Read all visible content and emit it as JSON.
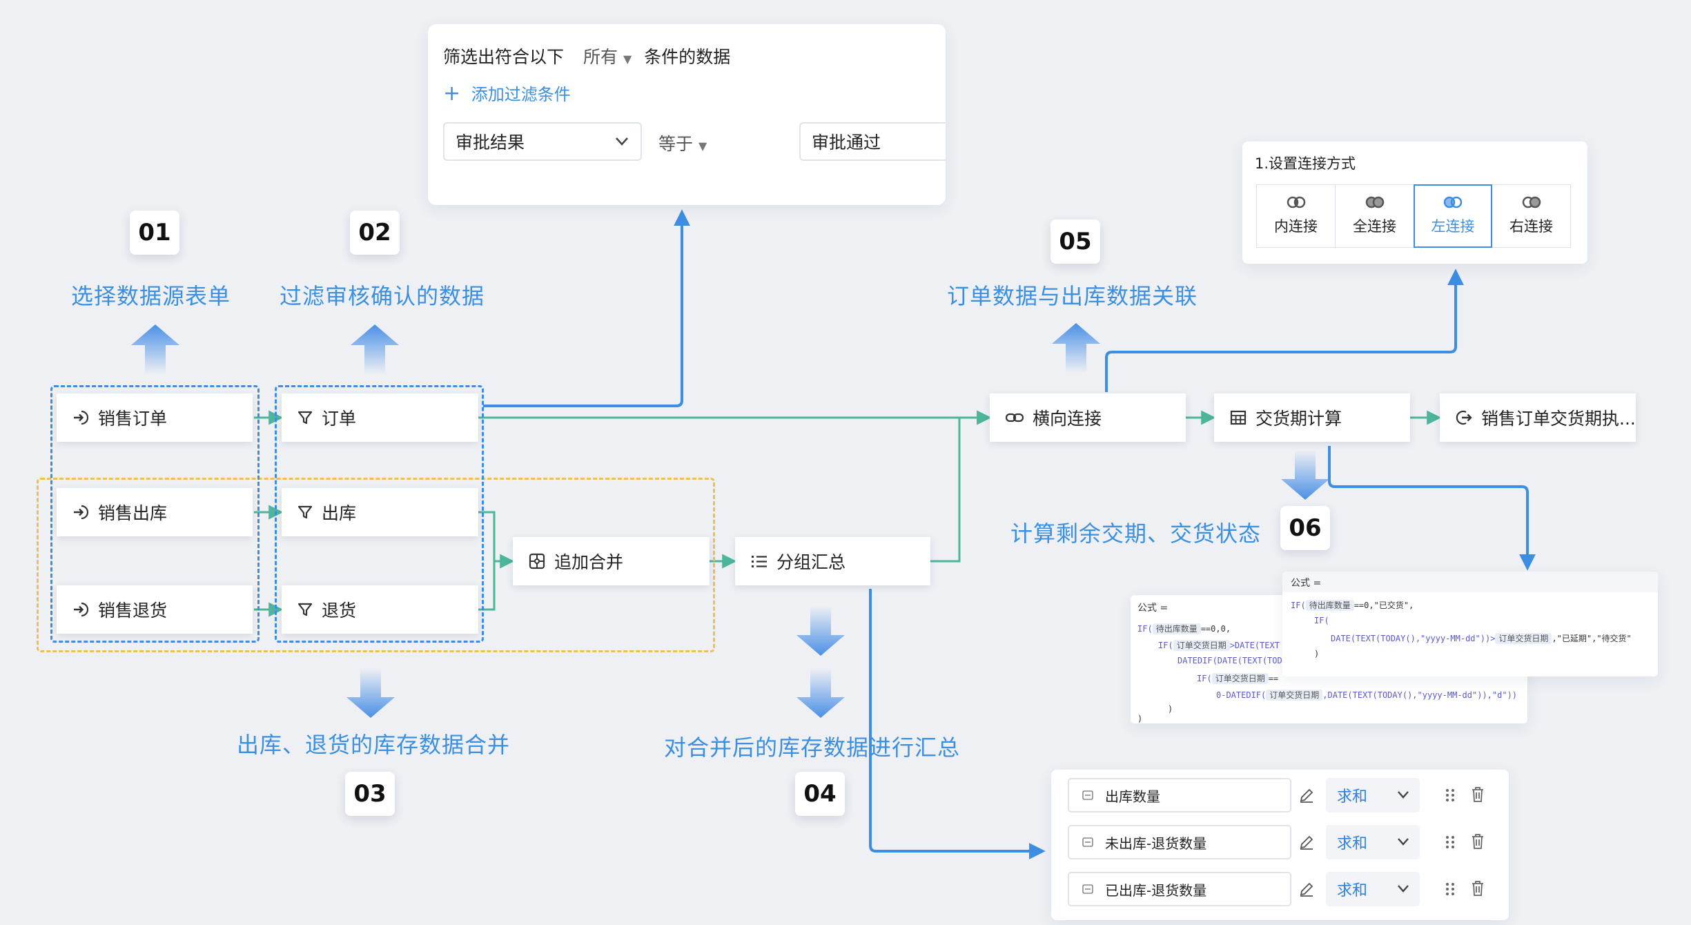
{
  "filter": {
    "prefix": "筛选出符合以下",
    "scope": "所有",
    "suffix": "条件的数据",
    "add_label": "添加过滤条件",
    "field": "审批结果",
    "operator": "等于",
    "value": "审批通过"
  },
  "join": {
    "title": "1.设置连接方式",
    "options": [
      "内连接",
      "全连接",
      "左连接",
      "右连接"
    ],
    "selected": "左连接"
  },
  "steps": [
    {
      "num": "01",
      "label": "选择数据源表单"
    },
    {
      "num": "02",
      "label": "过滤审核确认的数据"
    },
    {
      "num": "03",
      "label": "出库、退货的库存数据合并"
    },
    {
      "num": "04",
      "label": "对合并后的库存数据进行汇总"
    },
    {
      "num": "05",
      "label": "订单数据与出库数据关联"
    },
    {
      "num": "06",
      "label": "计算剩余交期、交货状态"
    }
  ],
  "nodes": {
    "src_order": "销售订单",
    "src_out": "销售出库",
    "src_return": "销售退货",
    "flt_order": "订单",
    "flt_out": "出库",
    "flt_return": "退货",
    "append": "追加合并",
    "group": "分组汇总",
    "hjoin": "横向连接",
    "calc": "交货期计算",
    "output": "销售订单交货期执..."
  },
  "formula_back": {
    "title": "公式 =",
    "l1_fn": "IF(",
    "l1_tag": "待出库数量",
    "l1_rest": "==0,0,",
    "l2_fn": "IF(",
    "l2_tag": "订单交货日期",
    "l2_rest": ">DATE(TEXT",
    "l3": "DATEDIF(DATE(TEXT(TOD",
    "l4_fn": "IF(",
    "l4_tag": "订单交货日期",
    "l4_rest": "==",
    "l5_pre": "0-DATEDIF(",
    "l5_tag": "订单交货日期",
    "l5_rest": ",DATE(TEXT(TODAY(),\"yyyy-MM-dd\")),\"d\"))",
    "l6": ")",
    "l7": ")"
  },
  "formula_front": {
    "title": "公式 =",
    "l1_fn": "IF(",
    "l1_tag": "待出库数量",
    "l1_rest": "==0,\"已交货\",",
    "l2": "IF(",
    "l3_pre": "DATE(TEXT(TODAY(),\"yyyy-MM-dd\"))>",
    "l3_tag": "订单交货日期",
    "l3_rest": ",\"已延期\",\"待交货\"",
    "l4": ")"
  },
  "aggregate": [
    {
      "field": "出库数量",
      "func": "求和"
    },
    {
      "field": "未出库-退货数量",
      "func": "求和"
    },
    {
      "field": "已出库-退货数量",
      "func": "求和"
    }
  ],
  "colors": {
    "blue": "#3d8ee3",
    "green": "#4db59a",
    "orange": "#f3bd52",
    "label_blue": "#3b8fe0"
  }
}
